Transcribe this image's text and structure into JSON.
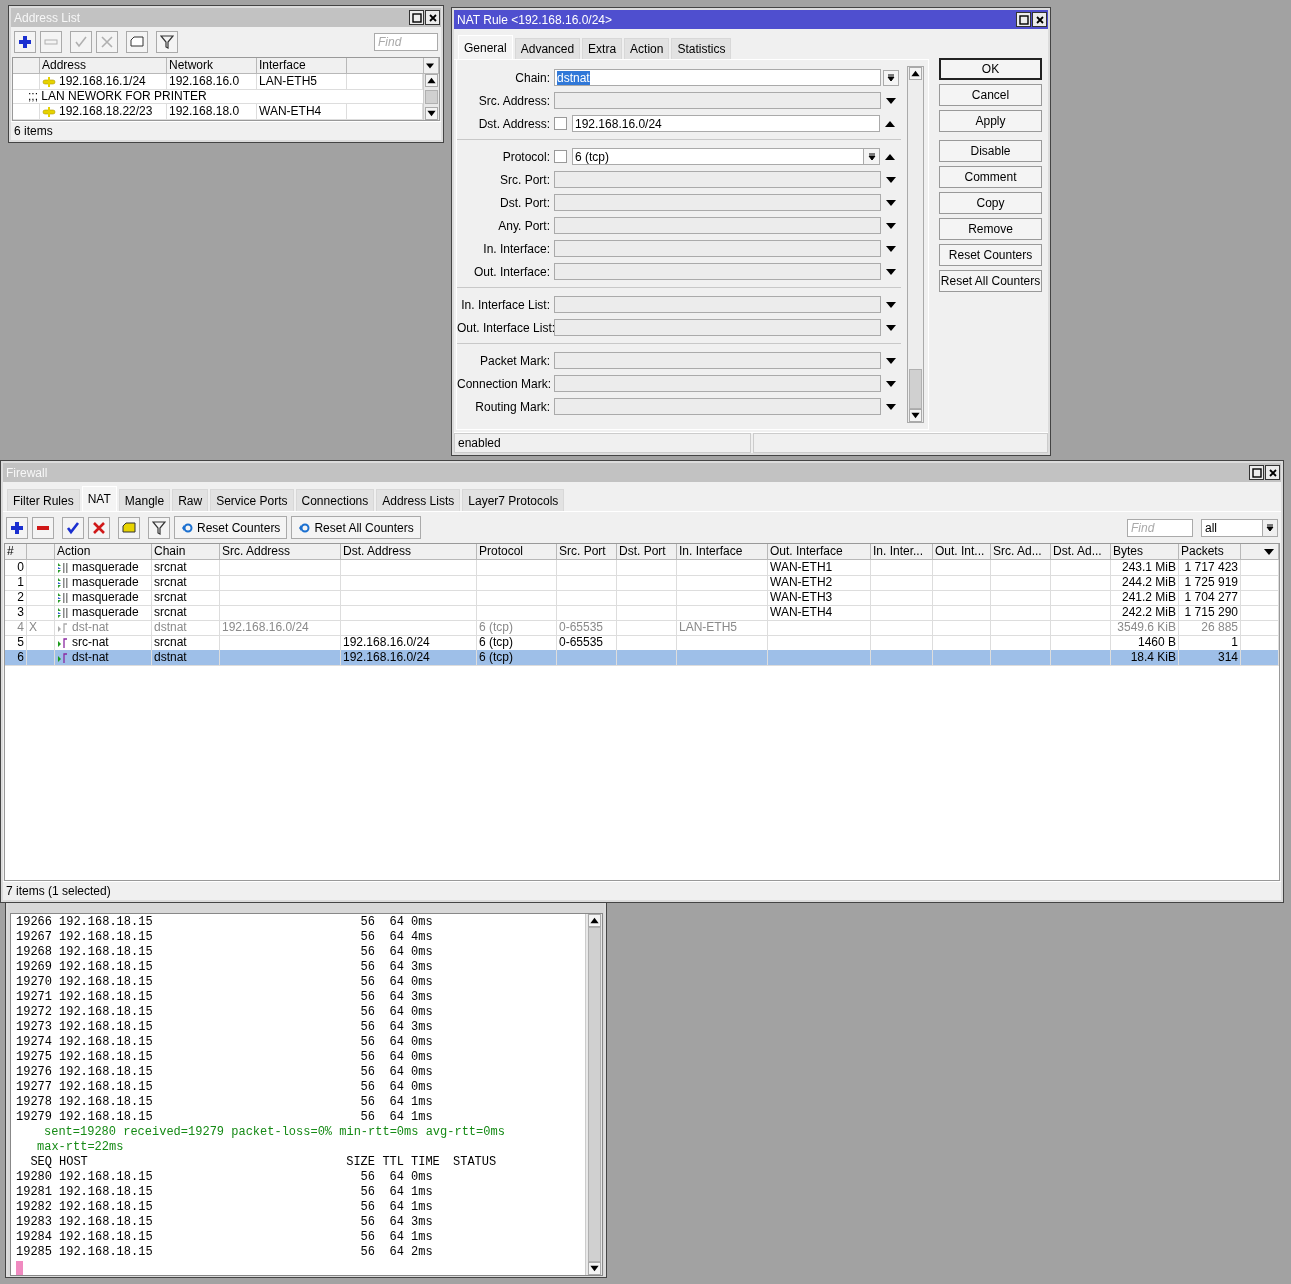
{
  "address_list": {
    "title": "Address List",
    "active": false,
    "toolbar": [
      {
        "kind": "add",
        "disabled": false
      },
      {
        "kind": "remove",
        "disabled": true
      },
      {
        "kind": "enable",
        "disabled": true
      },
      {
        "kind": "disable",
        "disabled": true
      },
      {
        "kind": "comment",
        "disabled": false
      },
      {
        "kind": "filter",
        "disabled": false
      }
    ],
    "find": {
      "placeholder": "Find"
    },
    "columns": [
      "Address",
      "Network",
      "Interface"
    ],
    "rows": [
      {
        "kind": "entry",
        "address": "192.168.16.1/24",
        "network": "192.168.16.0",
        "interface": "LAN-ETH5"
      },
      {
        "kind": "comment",
        "text": ";;; LAN NEWORK FOR PRINTER"
      },
      {
        "kind": "entry",
        "address": "192.168.18.22/23",
        "network": "192.168.18.0",
        "interface": "WAN-ETH4"
      }
    ],
    "status": "6 items"
  },
  "nat_rule": {
    "title": "NAT Rule <192.168.16.0/24>",
    "active": true,
    "tabs": [
      {
        "label": "General",
        "selected": true
      },
      {
        "label": "Advanced",
        "selected": false
      },
      {
        "label": "Extra",
        "selected": false
      },
      {
        "label": "Action",
        "selected": false
      },
      {
        "label": "Statistics",
        "selected": false
      }
    ],
    "groups": [
      [
        {
          "label": "Chain:",
          "kind": "select",
          "value": "dstnat",
          "value_selected": true
        },
        {
          "label": "Src. Address:",
          "kind": "condition",
          "expanded": false
        },
        {
          "label": "Dst. Address:",
          "kind": "condition",
          "expanded": true,
          "inverted": false,
          "dropdown": false,
          "value": "192.168.16.0/24"
        }
      ],
      [
        {
          "label": "Protocol:",
          "kind": "condition",
          "expanded": true,
          "inverted": false,
          "dropdown": true,
          "value": "6 (tcp)"
        },
        {
          "label": "Src. Port:",
          "kind": "condition",
          "expanded": false
        },
        {
          "label": "Dst. Port:",
          "kind": "condition",
          "expanded": false
        },
        {
          "label": "Any. Port:",
          "kind": "condition",
          "expanded": false
        },
        {
          "label": "In. Interface:",
          "kind": "condition",
          "expanded": false
        },
        {
          "label": "Out. Interface:",
          "kind": "condition",
          "expanded": false
        }
      ],
      [
        {
          "label": "In. Interface List:",
          "kind": "condition",
          "expanded": false
        },
        {
          "label": "Out. Interface List:",
          "kind": "condition",
          "expanded": false
        }
      ],
      [
        {
          "label": "Packet Mark:",
          "kind": "condition",
          "expanded": false
        },
        {
          "label": "Connection Mark:",
          "kind": "condition",
          "expanded": false
        },
        {
          "label": "Routing Mark:",
          "kind": "condition",
          "expanded": false
        }
      ]
    ],
    "button_groups": [
      [
        {
          "label": "OK",
          "default": true
        },
        {
          "label": "Cancel",
          "default": false
        },
        {
          "label": "Apply",
          "default": false
        }
      ],
      [
        {
          "label": "Disable",
          "default": false
        },
        {
          "label": "Comment",
          "default": false
        },
        {
          "label": "Copy",
          "default": false
        },
        {
          "label": "Remove",
          "default": false
        },
        {
          "label": "Reset Counters",
          "default": false
        },
        {
          "label": "Reset All Counters",
          "default": false
        }
      ]
    ],
    "status": "enabled"
  },
  "firewall": {
    "title": "Firewall",
    "active": false,
    "tabs": [
      {
        "label": "Filter Rules",
        "selected": false
      },
      {
        "label": "NAT",
        "selected": true
      },
      {
        "label": "Mangle",
        "selected": false
      },
      {
        "label": "Raw",
        "selected": false
      },
      {
        "label": "Service Ports",
        "selected": false
      },
      {
        "label": "Connections",
        "selected": false
      },
      {
        "label": "Address Lists",
        "selected": false
      },
      {
        "label": "Layer7 Protocols",
        "selected": false
      }
    ],
    "toolbar": [
      {
        "kind": "add",
        "disabled": false
      },
      {
        "kind": "remove",
        "disabled": false
      },
      {
        "kind": "enable",
        "disabled": false
      },
      {
        "kind": "disable",
        "disabled": false
      },
      {
        "kind": "comment",
        "disabled": false
      },
      {
        "kind": "filter",
        "disabled": false
      }
    ],
    "counter_buttons": [
      "Reset Counters",
      "Reset All Counters"
    ],
    "find": {
      "placeholder": "Find"
    },
    "filter_select": "all",
    "columns": [
      "#",
      "Action",
      "Chain",
      "Src. Address",
      "Dst. Address",
      "Protocol",
      "Src. Port",
      "Dst. Port",
      "In. Interface",
      "Out. Interface",
      "In. Inter...",
      "Out. Int...",
      "Src. Ad...",
      "Dst. Ad...",
      "Bytes",
      "Packets"
    ],
    "rows": [
      {
        "num": "0",
        "kind": "masquerade",
        "action": "masquerade",
        "chain": "srcnat",
        "out_interface": "WAN-ETH1",
        "bytes": "243.1 MiB",
        "packets": "1 717 423",
        "disabled": false,
        "selected": false
      },
      {
        "num": "1",
        "kind": "masquerade",
        "action": "masquerade",
        "chain": "srcnat",
        "out_interface": "WAN-ETH2",
        "bytes": "244.2 MiB",
        "packets": "1 725 919",
        "disabled": false,
        "selected": false
      },
      {
        "num": "2",
        "kind": "masquerade",
        "action": "masquerade",
        "chain": "srcnat",
        "out_interface": "WAN-ETH3",
        "bytes": "241.2 MiB",
        "packets": "1 704 277",
        "disabled": false,
        "selected": false
      },
      {
        "num": "3",
        "kind": "masquerade",
        "action": "masquerade",
        "chain": "srcnat",
        "out_interface": "WAN-ETH4",
        "bytes": "242.2 MiB",
        "packets": "1 715 290",
        "disabled": false,
        "selected": false
      },
      {
        "num": "4",
        "flag": "X",
        "kind": "nat",
        "action": "dst-nat",
        "chain": "dstnat",
        "src_address": "192.168.16.0/24",
        "protocol": "6 (tcp)",
        "src_port": "0-65535",
        "in_interface": "LAN-ETH5",
        "bytes": "3549.6 KiB",
        "packets": "26 885",
        "disabled": true,
        "selected": false
      },
      {
        "num": "5",
        "kind": "nat",
        "action": "src-nat",
        "chain": "srcnat",
        "dst_address": "192.168.16.0/24",
        "protocol": "6 (tcp)",
        "src_port": "0-65535",
        "bytes": "1460 B",
        "packets": "1",
        "disabled": false,
        "selected": false
      },
      {
        "num": "6",
        "kind": "nat",
        "action": "dst-nat",
        "chain": "dstnat",
        "dst_address": "192.168.16.0/24",
        "protocol": "6 (tcp)",
        "bytes": "18.4 KiB",
        "packets": "314",
        "disabled": false,
        "selected": true
      }
    ],
    "status": "7 items (1 selected)"
  },
  "terminal": {
    "lines": [
      {
        "kind": "ping",
        "seq": "19266",
        "host": "192.168.18.15",
        "size": "56",
        "ttl": "64",
        "time": "0ms"
      },
      {
        "kind": "ping",
        "seq": "19267",
        "host": "192.168.18.15",
        "size": "56",
        "ttl": "64",
        "time": "4ms"
      },
      {
        "kind": "ping",
        "seq": "19268",
        "host": "192.168.18.15",
        "size": "56",
        "ttl": "64",
        "time": "0ms"
      },
      {
        "kind": "ping",
        "seq": "19269",
        "host": "192.168.18.15",
        "size": "56",
        "ttl": "64",
        "time": "3ms"
      },
      {
        "kind": "ping",
        "seq": "19270",
        "host": "192.168.18.15",
        "size": "56",
        "ttl": "64",
        "time": "0ms"
      },
      {
        "kind": "ping",
        "seq": "19271",
        "host": "192.168.18.15",
        "size": "56",
        "ttl": "64",
        "time": "3ms"
      },
      {
        "kind": "ping",
        "seq": "19272",
        "host": "192.168.18.15",
        "size": "56",
        "ttl": "64",
        "time": "0ms"
      },
      {
        "kind": "ping",
        "seq": "19273",
        "host": "192.168.18.15",
        "size": "56",
        "ttl": "64",
        "time": "3ms"
      },
      {
        "kind": "ping",
        "seq": "19274",
        "host": "192.168.18.15",
        "size": "56",
        "ttl": "64",
        "time": "0ms"
      },
      {
        "kind": "ping",
        "seq": "19275",
        "host": "192.168.18.15",
        "size": "56",
        "ttl": "64",
        "time": "0ms"
      },
      {
        "kind": "ping",
        "seq": "19276",
        "host": "192.168.18.15",
        "size": "56",
        "ttl": "64",
        "time": "0ms"
      },
      {
        "kind": "ping",
        "seq": "19277",
        "host": "192.168.18.15",
        "size": "56",
        "ttl": "64",
        "time": "0ms"
      },
      {
        "kind": "ping",
        "seq": "19278",
        "host": "192.168.18.15",
        "size": "56",
        "ttl": "64",
        "time": "1ms"
      },
      {
        "kind": "ping",
        "seq": "19279",
        "host": "192.168.18.15",
        "size": "56",
        "ttl": "64",
        "time": "1ms"
      },
      {
        "kind": "summary",
        "text": "sent=19280 received=19279 packet-loss=0% min-rtt=0ms avg-rtt=0ms"
      },
      {
        "kind": "summary_cont",
        "text": "max-rtt=22ms"
      },
      {
        "kind": "header",
        "seq": "SEQ",
        "host": "HOST",
        "size": "SIZE",
        "ttl": "TTL",
        "time": "TIME",
        "status": "STATUS"
      },
      {
        "kind": "ping",
        "seq": "19280",
        "host": "192.168.18.15",
        "size": "56",
        "ttl": "64",
        "time": "0ms"
      },
      {
        "kind": "ping",
        "seq": "19281",
        "host": "192.168.18.15",
        "size": "56",
        "ttl": "64",
        "time": "1ms"
      },
      {
        "kind": "ping",
        "seq": "19282",
        "host": "192.168.18.15",
        "size": "56",
        "ttl": "64",
        "time": "1ms"
      },
      {
        "kind": "ping",
        "seq": "19283",
        "host": "192.168.18.15",
        "size": "56",
        "ttl": "64",
        "time": "3ms"
      },
      {
        "kind": "ping",
        "seq": "19284",
        "host": "192.168.18.15",
        "size": "56",
        "ttl": "64",
        "time": "1ms"
      },
      {
        "kind": "ping",
        "seq": "19285",
        "host": "192.168.18.15",
        "size": "56",
        "ttl": "64",
        "time": "2ms"
      }
    ]
  }
}
